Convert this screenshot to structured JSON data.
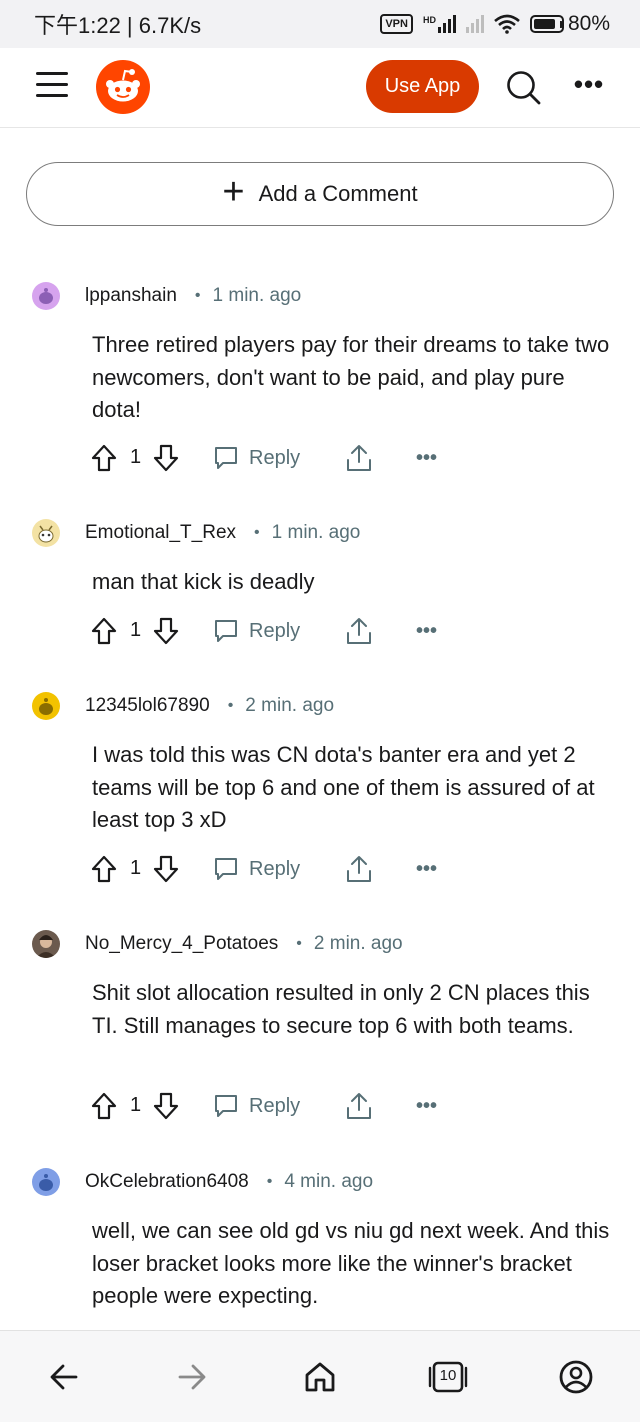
{
  "status_bar": {
    "time_speed": "下午1:22 | 6.7K/s",
    "vpn_label": "VPN",
    "hd_label": "HD",
    "battery": "80%"
  },
  "header": {
    "use_app_label": "Use App",
    "brand_color": "#d93a00"
  },
  "add_comment": {
    "label": "Add a Comment"
  },
  "comments": [
    {
      "author": "lppanshain",
      "time": "1 min. ago",
      "body": "Three retired players pay for their dreams to take two newcomers, don't want to be paid, and play pure dota!",
      "score": "1",
      "reply_label": "Reply",
      "avatar_color": "#d6a3ee"
    },
    {
      "author": "Emotional_T_Rex",
      "time": "1 min. ago",
      "body": "man that kick is deadly",
      "score": "1",
      "reply_label": "Reply",
      "avatar_color": "#f3e2a4"
    },
    {
      "author": "12345lol67890",
      "time": "2 min. ago",
      "body": "I was told this was CN dota's banter era and yet 2 teams will be top 6 and one of them is assured of at least top 3 xD",
      "score": "1",
      "reply_label": "Reply",
      "avatar_color": "#f2c200"
    },
    {
      "author": "No_Mercy_4_Potatoes",
      "time": "2 min. ago",
      "body": "Shit slot allocation resulted in only 2 CN places this TI. Still manages to secure top 6 with both teams.",
      "score": "1",
      "reply_label": "Reply",
      "avatar_color": "#6b5a4e"
    },
    {
      "author": "OkCelebration6408",
      "time": "4 min. ago",
      "body": "well, we can see old gd vs niu gd next week. And this loser bracket looks more like the winner's bracket people were expecting.",
      "score": "",
      "reply_label": "",
      "avatar_color": "#7f9ee6"
    }
  ],
  "bottom_nav": {
    "tab_count": "10"
  }
}
